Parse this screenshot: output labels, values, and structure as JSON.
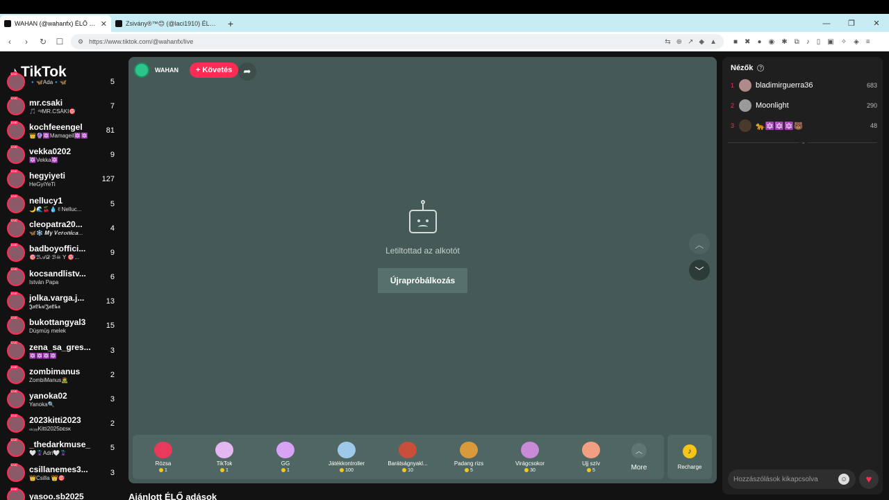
{
  "browser": {
    "tabs": [
      {
        "title": "WAHAN (@wahanfx) ÉLŐ adásb…",
        "active": true
      },
      {
        "title": "Zsivány®™😊 (@laci1910) ÉLŐ a…",
        "active": false
      }
    ],
    "new_tab": "+",
    "window_controls": [
      "—",
      "❐",
      "✕"
    ],
    "url": "https://www.tiktok.com/@wahanfx/live"
  },
  "logo": "TikTok",
  "following": [
    {
      "name": "",
      "sub": "🔹🦋Ada🔹🦋",
      "count": "5"
    },
    {
      "name": "mr.csaki",
      "sub": "🎵 ⁴ᵍMR.CSÁKI🎯",
      "count": "7"
    },
    {
      "name": "kochfeeengel",
      "sub": "👑🔮🔯Mamageil🔯🔯",
      "count": "81"
    },
    {
      "name": "vekka0202",
      "sub": "🔯Vekka🔯",
      "count": "9"
    },
    {
      "name": "hegyiyeti",
      "sub": "HeGyiYeTi",
      "count": "127"
    },
    {
      "name": "nellucy1",
      "sub": "🌙🌊🍒💧✌Nelluc...",
      "count": "5"
    },
    {
      "name": "cleopatra20...",
      "sub": "🦋❄️ 𝑴𝒚 𝑽𝒆𝒓𝒐𝒏𝒊𝒄𝒂...",
      "count": "4"
    },
    {
      "name": "badboyoffici...",
      "sub": "🎯ℬ𝒜𝒟 ℬ☠ Y 🎯...",
      "count": "9"
    },
    {
      "name": "kocsandlistv...",
      "sub": "István Papa",
      "count": "6"
    },
    {
      "name": "jolka.varga.j...",
      "sub": "𝕵𝖔𝕷𝖐𝖆/𝕵𝖔𝕷𝖐𝖆",
      "count": "13"
    },
    {
      "name": "bukottangyal3",
      "sub": "Düşmüş melek",
      "count": "15"
    },
    {
      "name": "zena_sa_gres...",
      "sub": "🔯🔯🔯🔯",
      "count": "3"
    },
    {
      "name": "zombimanus",
      "sub": "ZombiManus🧟",
      "count": "2"
    },
    {
      "name": "yanoka02",
      "sub": "Yanoka🔍",
      "count": "3"
    },
    {
      "name": "2023kitti2023",
      "sub": "ₛₖᵢᵣₑKitti2025ᴅᴇsᴋ",
      "count": "2"
    },
    {
      "name": "_thedarkmuse_",
      "sub": "🤍🦹Adri🤍🦹",
      "count": "5"
    },
    {
      "name": "csillanemes3...",
      "sub": "👑Csilla 👑🎯",
      "count": "3"
    },
    {
      "name": "yasoo.sb2025",
      "sub": "",
      "count": ""
    }
  ],
  "player": {
    "host_name": "WAHAN",
    "follow_label": "+ Követés",
    "blocked_text": "Letiltottad az alkotót",
    "retry_label": "Újrapróbálkozás"
  },
  "gifts": [
    {
      "name": "Rózsa",
      "price": "1",
      "color": "#e83a5a"
    },
    {
      "name": "TikTok",
      "price": "1",
      "color": "#e4b7f0"
    },
    {
      "name": "GG",
      "price": "1",
      "color": "#d8a2f5"
    },
    {
      "name": "Játékkontroller",
      "price": "100",
      "color": "#9ec9e8"
    },
    {
      "name": "Barátságnyakl...",
      "price": "10",
      "color": "#c8503a"
    },
    {
      "name": "Padang rizs",
      "price": "5",
      "color": "#d89a3a"
    },
    {
      "name": "Virágcsokor",
      "price": "30",
      "color": "#c98ad8"
    },
    {
      "name": "Ujj szív",
      "price": "5",
      "color": "#f0a080"
    }
  ],
  "more_label": "More",
  "recharge_label": "Recharge",
  "recommended_title": "Ajánlott ÉLŐ adások",
  "viewers": {
    "title": "Nézők",
    "list": [
      {
        "rank": "1",
        "name": "bladimirguerra36",
        "score": "683"
      },
      {
        "rank": "2",
        "name": "Moonlight",
        "score": "290"
      },
      {
        "rank": "3",
        "name": "🐆🔯🔯🔯🐻",
        "score": "48"
      }
    ]
  },
  "comment_placeholder": "Hozzászólások kikapcsolva"
}
